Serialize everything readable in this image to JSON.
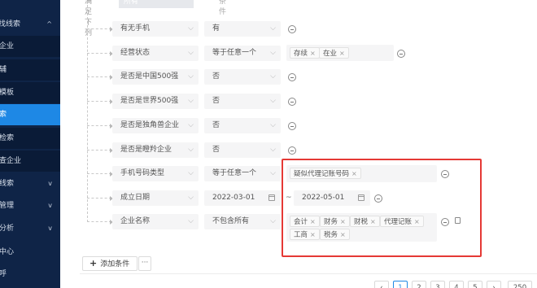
{
  "sidebar": {
    "items": [
      {
        "label": "找线索",
        "chevron": "^"
      },
      {
        "label": "企业"
      },
      {
        "label": "辅"
      },
      {
        "label": "模板"
      },
      {
        "label": "索"
      },
      {
        "label": "检索"
      },
      {
        "label": "查企业"
      },
      {
        "label": "线索",
        "chevron": "v"
      },
      {
        "label": "管理",
        "chevron": "v"
      },
      {
        "label": "分析",
        "chevron": "v"
      },
      {
        "label": "中心"
      },
      {
        "label": "呼"
      }
    ]
  },
  "top_strip": {
    "label": "满足下列",
    "value": "所有",
    "suffix": "条件"
  },
  "conditions": [
    {
      "field": "有无手机",
      "operator": "有"
    },
    {
      "field": "经营状态",
      "operator": "等于任意一个",
      "tags": [
        "存续",
        "在业"
      ]
    },
    {
      "field": "是否是中国500强",
      "operator": "否"
    },
    {
      "field": "是否是世界500强",
      "operator": "否"
    },
    {
      "field": "是否是独角兽企业",
      "operator": "否"
    },
    {
      "field": "是否是瞪羚企业",
      "operator": "否"
    },
    {
      "field": "手机号码类型",
      "operator": "等于任意一个",
      "tags": [
        "疑似代理记账号码"
      ]
    },
    {
      "field": "成立日期",
      "date_from": "2022-03-01",
      "range_sep": "~",
      "date_to": "2022-05-01"
    },
    {
      "field": "企业名称",
      "operator": "不包含所有",
      "tags": [
        "会计",
        "财务",
        "财税",
        "代理记账",
        "工商",
        "税务"
      ]
    }
  ],
  "icons": {
    "dropdown": "chevron-down-icon",
    "remove": "minus-circle-icon",
    "calendar": "calendar-icon",
    "copy": "copy-icon",
    "tag_close": "close-icon"
  },
  "actions": {
    "add_label": "添加条件",
    "plus_symbol": "+",
    "more_label": "···"
  },
  "pagination": {
    "pages": [
      "‹",
      "1",
      "2",
      "3",
      "4",
      "5",
      "›"
    ],
    "current": "1",
    "page_size": "250"
  },
  "colors": {
    "sidebar_bg": "#0f2447",
    "accent": "#1e88e5",
    "highlight": "#e53935"
  }
}
